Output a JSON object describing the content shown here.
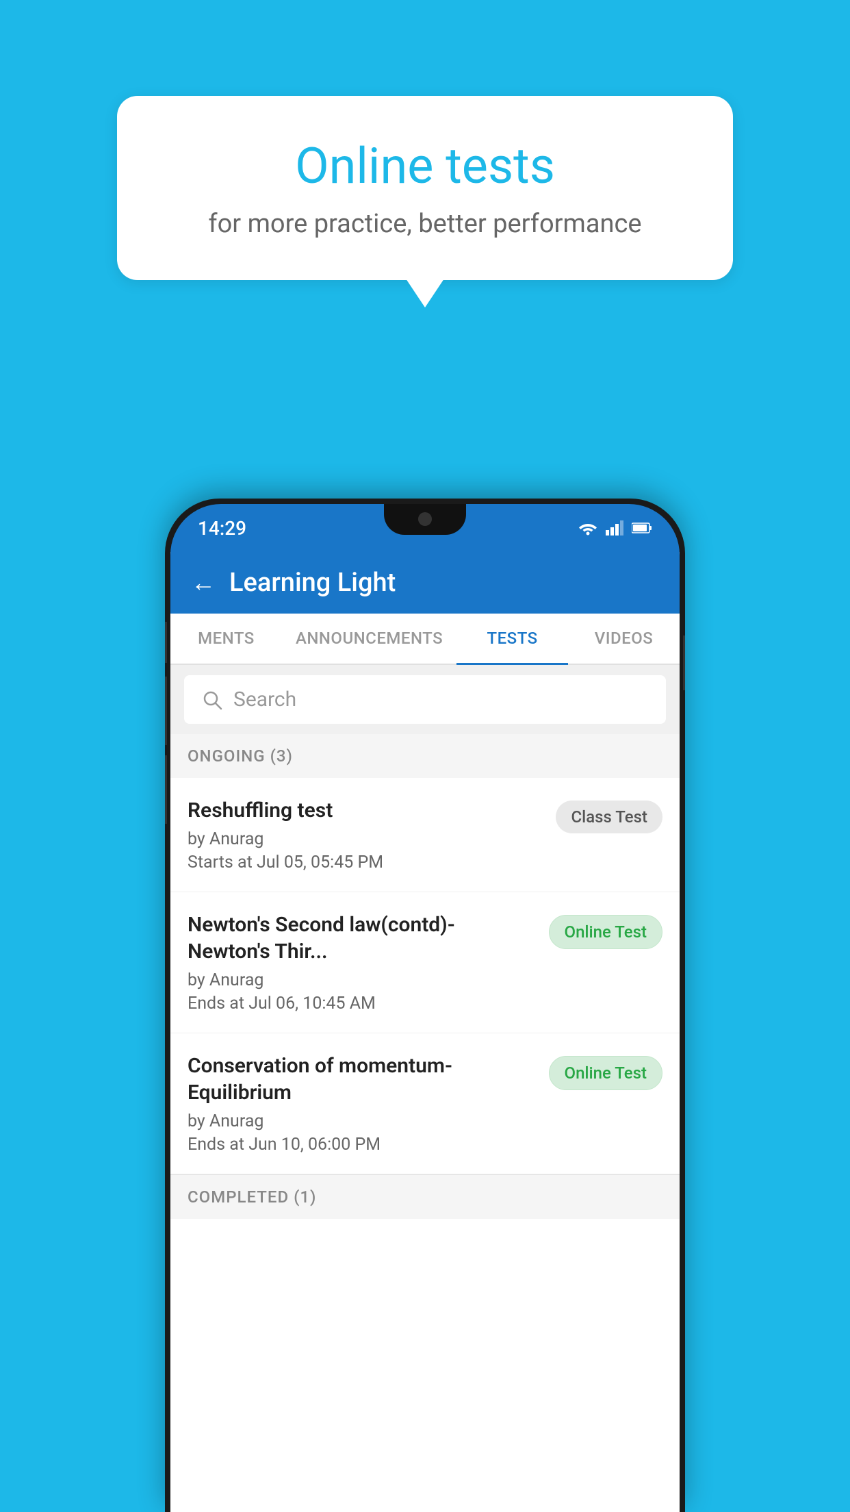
{
  "background": {
    "color": "#1DB8E8"
  },
  "speech_bubble": {
    "title": "Online tests",
    "subtitle": "for more practice, better performance"
  },
  "status_bar": {
    "time": "14:29",
    "icons": [
      "wifi",
      "signal",
      "battery"
    ]
  },
  "app_header": {
    "title": "Learning Light",
    "back_label": "←"
  },
  "tabs": [
    {
      "label": "MENTS",
      "active": false
    },
    {
      "label": "ANNOUNCEMENTS",
      "active": false
    },
    {
      "label": "TESTS",
      "active": true
    },
    {
      "label": "VIDEOS",
      "active": false
    }
  ],
  "search": {
    "placeholder": "Search"
  },
  "ongoing_section": {
    "title": "ONGOING (3)"
  },
  "test_items": [
    {
      "name": "Reshuffling test",
      "author": "by Anurag",
      "date": "Starts at  Jul 05, 05:45 PM",
      "badge": "Class Test",
      "badge_type": "class"
    },
    {
      "name": "Newton's Second law(contd)-Newton's Thir...",
      "author": "by Anurag",
      "date": "Ends at  Jul 06, 10:45 AM",
      "badge": "Online Test",
      "badge_type": "online"
    },
    {
      "name": "Conservation of momentum-Equilibrium",
      "author": "by Anurag",
      "date": "Ends at  Jun 10, 06:00 PM",
      "badge": "Online Test",
      "badge_type": "online"
    }
  ],
  "completed_section": {
    "title": "COMPLETED (1)"
  }
}
